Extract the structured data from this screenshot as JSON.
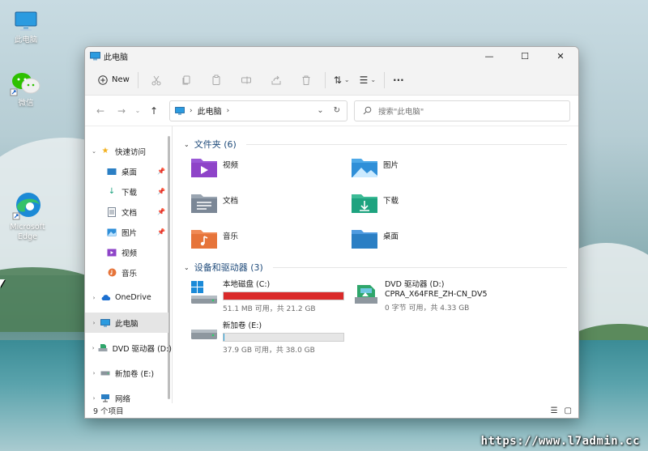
{
  "desktop": {
    "icons": [
      {
        "name": "此电脑"
      },
      {
        "name": "微信"
      },
      {
        "name": "Microsoft Edge"
      }
    ],
    "watermark": "https://www.l7admin.cc"
  },
  "window": {
    "title": "此电脑",
    "controls": {
      "minimize": "—",
      "maximize": "☐",
      "close": "✕"
    }
  },
  "toolbar": {
    "new_label": "New",
    "sort_icon": "⇅",
    "view_icon": "☰",
    "more_icon": "···"
  },
  "address": {
    "crumb": "此电脑",
    "search_placeholder": "搜索\"此电脑\""
  },
  "nav": {
    "quick_access": "快速访问",
    "quick_items": [
      {
        "label": "桌面",
        "icon": "desktop-icon"
      },
      {
        "label": "下载",
        "icon": "download-icon"
      },
      {
        "label": "文档",
        "icon": "document-icon"
      },
      {
        "label": "图片",
        "icon": "picture-icon"
      },
      {
        "label": "视频",
        "icon": "video-icon"
      },
      {
        "label": "音乐",
        "icon": "music-icon"
      }
    ],
    "onedrive": "OneDrive",
    "this_pc": "此电脑",
    "dvd": "DVD 驱动器 (D:)",
    "new_volume": "新加卷 (E:)",
    "network": "网络"
  },
  "main": {
    "folders_header": "文件夹 (6)",
    "folders": [
      {
        "name": "视频",
        "color": "#8e44c8"
      },
      {
        "name": "图片",
        "color": "#2f8fd8"
      },
      {
        "name": "文档",
        "color": "#7b8796"
      },
      {
        "name": "下载",
        "color": "#1ea37f"
      },
      {
        "name": "音乐",
        "color": "#e6743a"
      },
      {
        "name": "桌面",
        "color": "#2b7fc4"
      }
    ],
    "drives_header": "设备和驱动器 (3)",
    "drives": [
      {
        "name": "本地磁盘 (C:)",
        "space": "51.1 MB 可用，共 21.2 GB",
        "used_fraction": 0.998,
        "bar_color": "#da2a2a"
      },
      {
        "name": "DVD 驱动器 (D:)",
        "subname": "CPRA_X64FRE_ZH-CN_DV5",
        "space": "0 字节 可用，共 4.33 GB"
      },
      {
        "name": "新加卷 (E:)",
        "space": "37.9 GB 可用，共 38.0 GB",
        "used_fraction": 0.003,
        "bar_color": "#26a0da"
      }
    ]
  },
  "status": {
    "count": "9 个项目"
  }
}
